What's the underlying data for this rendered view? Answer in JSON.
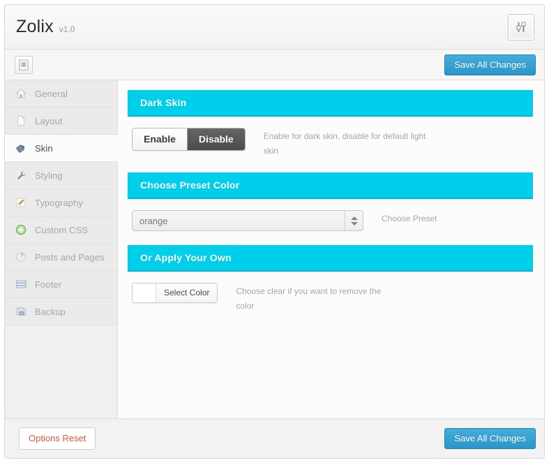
{
  "header": {
    "brand": "Zolix",
    "version": "v1.0",
    "settings_icon": "sliders-icon"
  },
  "toolbar": {
    "menu_toggle_icon": "panel-collapse-icon",
    "save_label": "Save All Changes"
  },
  "sidebar": {
    "items": [
      {
        "label": "General",
        "icon": "home-icon",
        "active": false
      },
      {
        "label": "Layout",
        "icon": "page-icon",
        "active": false
      },
      {
        "label": "Skin",
        "icon": "paint-bucket-icon",
        "active": true
      },
      {
        "label": "Styling",
        "icon": "wrench-icon",
        "active": false
      },
      {
        "label": "Typography",
        "icon": "pencil-icon",
        "active": false
      },
      {
        "label": "Custom CSS",
        "icon": "plus-circle-icon",
        "active": false
      },
      {
        "label": "Posts and Pages",
        "icon": "pie-clock-icon",
        "active": false
      },
      {
        "label": "Footer",
        "icon": "stacked-lines-icon",
        "active": false
      },
      {
        "label": "Backup",
        "icon": "floppy-disk-icon",
        "active": false
      }
    ]
  },
  "content": {
    "sections": [
      {
        "title": "Dark Skin",
        "type": "toggle",
        "options": [
          "Enable",
          "Disable"
        ],
        "selected": "Disable",
        "description": "Enable for dark skin, disable for default light skin"
      },
      {
        "title": "Choose Preset Color",
        "type": "select",
        "value": "orange",
        "description": "Choose Preset"
      },
      {
        "title": "Or Apply Your Own",
        "type": "color",
        "button_label": "Select Color",
        "swatch_color": "#ffffff",
        "description": "Choose clear if you want to remove the color"
      }
    ]
  },
  "footer": {
    "reset_label": "Options Reset",
    "save_label": "Save All Changes"
  },
  "colors": {
    "accent_cyan": "#00cfec",
    "accent_cyan_border": "#00b9d4",
    "save_blue": "#2b95c9",
    "reset_red": "#e8533a",
    "toggle_active": "#4b4b4b"
  }
}
